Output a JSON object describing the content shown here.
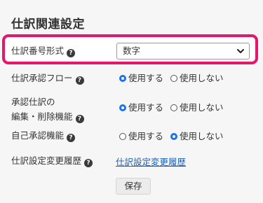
{
  "page": {
    "title": "仕訳関連設定"
  },
  "settings": {
    "journal_number_format": {
      "label": "仕訳番号形式",
      "help_icon": "question-circle-icon",
      "selected": "数字",
      "chevron_icon": "chevron-down-icon"
    },
    "approval_flow": {
      "label": "仕訳承認フロー",
      "help_icon": "question-circle-icon",
      "options": [
        "使用する",
        "使用しない"
      ],
      "selected": "使用する"
    },
    "edit_delete": {
      "label_line1": "承認仕訳の",
      "label_line2": "編集・削除機能",
      "help_icon": "question-circle-icon",
      "options": [
        "使用する",
        "使用しない"
      ],
      "selected": "使用する"
    },
    "self_approval": {
      "label": "自己承認機能",
      "help_icon": "question-circle-icon",
      "options": [
        "使用する",
        "使用しない"
      ],
      "selected": "使用しない"
    },
    "change_history": {
      "label": "仕訳設定変更履歴",
      "help_icon": "question-circle-icon",
      "link_text": "仕訳設定変更履歴"
    }
  },
  "actions": {
    "save_label": "保存"
  },
  "colors": {
    "highlight_border": "#e5176d",
    "radio_checked": "#1a73e8",
    "link": "#1a5fb4"
  }
}
